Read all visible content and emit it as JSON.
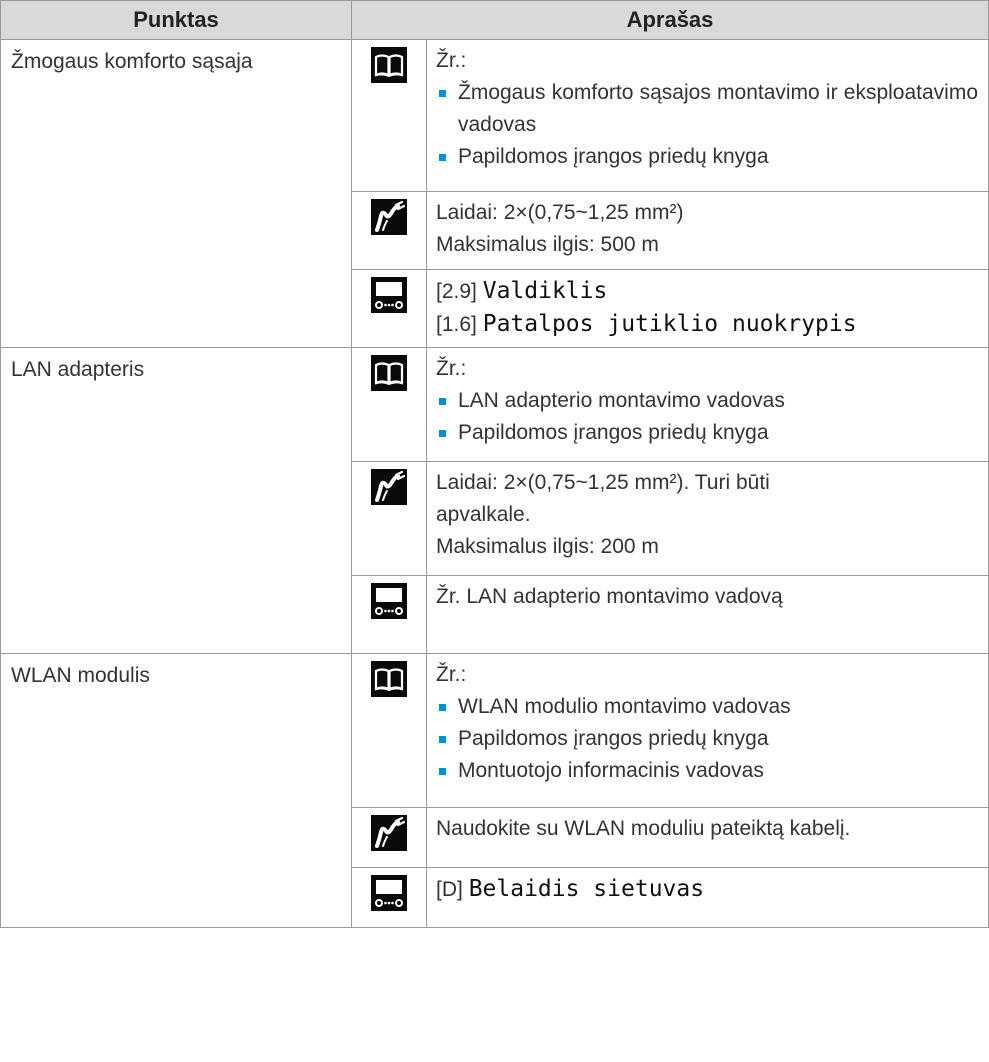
{
  "header": {
    "item": "Punktas",
    "description": "Aprašas"
  },
  "icons": {
    "manual": "book-icon",
    "wiring": "cable-icon",
    "settings": "controller-icon"
  },
  "accent_color": "#0091d5",
  "rows": [
    {
      "item": "Žmogaus komforto sąsaja",
      "manual": {
        "intro": "Žr.:",
        "bullets": [
          "Žmogaus komforto sąsajos montavimo ir eksploatavimo vadovas",
          "Papildomos įrangos priedų knyga"
        ]
      },
      "wiring": {
        "lines": [
          "Laidai: 2×(0,75~1,25 mm²)",
          "Maksimalus ilgis: 500 m"
        ]
      },
      "settings": {
        "lines": [
          {
            "code": "[2.9]",
            "name": "Valdiklis"
          },
          {
            "code": "[1.6]",
            "name": "Patalpos jutiklio nuokrypis"
          }
        ]
      }
    },
    {
      "item": "LAN adapteris",
      "manual": {
        "intro": "Žr.:",
        "bullets": [
          "LAN adapterio montavimo vadovas",
          "Papildomos įrangos priedų knyga"
        ]
      },
      "wiring": {
        "lines": [
          "Laidai: 2×(0,75~1,25 mm²). Turi būti apvalkale.",
          "Maksimalus ilgis: 200 m"
        ]
      },
      "settings": {
        "text": "Žr. LAN adapterio montavimo vadovą"
      }
    },
    {
      "item": "WLAN modulis",
      "manual": {
        "intro": "Žr.:",
        "bullets": [
          "WLAN modulio montavimo vadovas",
          "Papildomos įrangos priedų knyga",
          "Montuotojo informacinis vadovas"
        ]
      },
      "wiring": {
        "text": "Naudokite su WLAN moduliu pateiktą kabelį."
      },
      "settings": {
        "lines": [
          {
            "code": "[D]",
            "name": "Belaidis sietuvas"
          }
        ]
      }
    }
  ]
}
